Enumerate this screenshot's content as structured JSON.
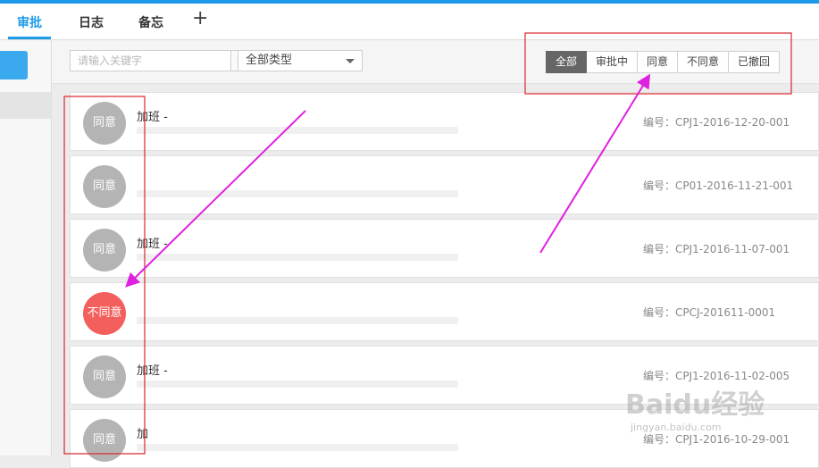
{
  "tabs": [
    {
      "label": "审批"
    },
    {
      "label": "日志"
    },
    {
      "label": "备忘"
    }
  ],
  "tab_add_label": "+",
  "search": {
    "placeholder": "请输入关键字"
  },
  "type_filter": {
    "selected": "全部类型"
  },
  "status_filters": [
    {
      "label": "全部"
    },
    {
      "label": "审批中"
    },
    {
      "label": "同意"
    },
    {
      "label": "不同意"
    },
    {
      "label": "已撤回"
    }
  ],
  "items": [
    {
      "status": "同意",
      "title": "加班 -",
      "number": "编号：CPJ1-2016-12-20-001"
    },
    {
      "status": "同意",
      "title": "",
      "number": "编号：CP01-2016-11-21-001"
    },
    {
      "status": "同意",
      "title": "加班 -",
      "number": "编号：CPJ1-2016-11-07-001"
    },
    {
      "status": "不同意",
      "title": "",
      "number": "编号：CPCJ-201611-0001"
    },
    {
      "status": "同意",
      "title": "加班 -",
      "number": "编号：CPJ1-2016-11-02-005"
    },
    {
      "status": "同意",
      "title": "加",
      "number": "编号：CPJ1-2016-10-29-001"
    }
  ],
  "watermark": {
    "logo": "Baidu经验",
    "url": "jingyan.baidu.com"
  },
  "colors": {
    "accent": "#1e9be8",
    "reject": "#f25f5c",
    "approve": "#b4b4b4",
    "annotation": "#e020e0",
    "highlight_box": "#d9262c"
  }
}
